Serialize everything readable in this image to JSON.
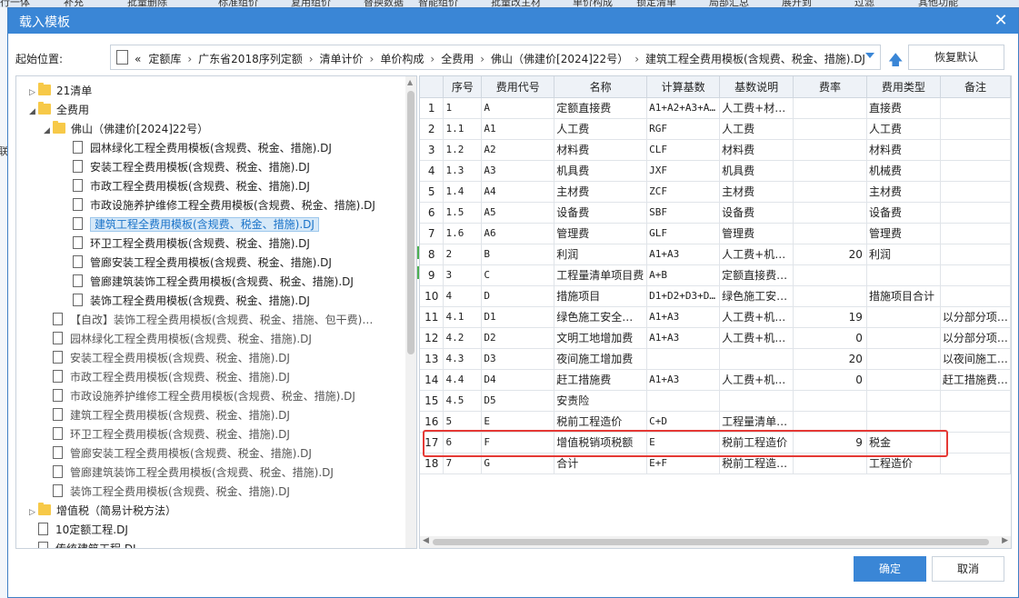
{
  "background": {
    "toolbar_items": [
      "行一体",
      "补充",
      "批量删除",
      "标准组价",
      "复用组价",
      "替换数据",
      "智能组价",
      "批量改主材",
      "单价构成",
      "锁定清单",
      "局部汇总",
      "展开到",
      "过滤",
      "其他功能"
    ],
    "left_fragment": "联"
  },
  "dialog": {
    "title": "载入模板",
    "close_glyph": "✕"
  },
  "path": {
    "label": "起始位置:",
    "prefix": "«",
    "crumbs": [
      "定额库",
      "广东省2018序列定额",
      "清单计价",
      "单价构成",
      "全费用",
      "佛山（佛建价[2024]22号）",
      "建筑工程全费用模板(含规费、税金、措施).DJ"
    ],
    "separator": "›",
    "up_glyph": "🡅",
    "restore_label": "恢复默认"
  },
  "tree": {
    "items": [
      {
        "indent": 0,
        "twisty": "▷",
        "kind": "folder",
        "label": "21清单"
      },
      {
        "indent": 0,
        "twisty": "◢",
        "kind": "folder",
        "label": "全费用"
      },
      {
        "indent": 1,
        "twisty": "◢",
        "kind": "folder",
        "label": "佛山（佛建价[2024]22号）"
      },
      {
        "indent": 2,
        "twisty": "",
        "kind": "doc",
        "label": "园林绿化工程全费用模板(含规费、税金、措施).DJ"
      },
      {
        "indent": 2,
        "twisty": "",
        "kind": "doc",
        "label": "安装工程全费用模板(含规费、税金、措施).DJ"
      },
      {
        "indent": 2,
        "twisty": "",
        "kind": "doc",
        "label": "市政工程全费用模板(含规费、税金、措施).DJ"
      },
      {
        "indent": 2,
        "twisty": "",
        "kind": "doc",
        "label": "市政设施养护维修工程全费用模板(含规费、税金、措施).DJ"
      },
      {
        "indent": 2,
        "twisty": "",
        "kind": "doc",
        "label": "建筑工程全费用模板(含规费、税金、措施).DJ",
        "selected": true
      },
      {
        "indent": 2,
        "twisty": "",
        "kind": "doc",
        "label": "环卫工程全费用模板(含规费、税金、措施).DJ"
      },
      {
        "indent": 2,
        "twisty": "",
        "kind": "doc",
        "label": "管廊安装工程全费用模板(含规费、税金、措施).DJ"
      },
      {
        "indent": 2,
        "twisty": "",
        "kind": "doc",
        "label": "管廊建筑装饰工程全费用模板(含规费、税金、措施).DJ"
      },
      {
        "indent": 2,
        "twisty": "",
        "kind": "doc",
        "label": "装饰工程全费用模板(含规费、税金、措施).DJ"
      },
      {
        "indent": 1,
        "twisty": "",
        "kind": "doc",
        "label": "【自改】装饰工程全费用模板(含规费、税金、措施、包干费)…",
        "dim": true
      },
      {
        "indent": 1,
        "twisty": "",
        "kind": "doc",
        "label": "园林绿化工程全费用模板(含规费、税金、措施).DJ",
        "dim": true
      },
      {
        "indent": 1,
        "twisty": "",
        "kind": "doc",
        "label": "安装工程全费用模板(含规费、税金、措施).DJ",
        "dim": true
      },
      {
        "indent": 1,
        "twisty": "",
        "kind": "doc",
        "label": "市政工程全费用模板(含规费、税金、措施).DJ",
        "dim": true
      },
      {
        "indent": 1,
        "twisty": "",
        "kind": "doc",
        "label": "市政设施养护维修工程全费用模板(含规费、税金、措施).DJ",
        "dim": true
      },
      {
        "indent": 1,
        "twisty": "",
        "kind": "doc",
        "label": "建筑工程全费用模板(含规费、税金、措施).DJ",
        "dim": true
      },
      {
        "indent": 1,
        "twisty": "",
        "kind": "doc",
        "label": "环卫工程全费用模板(含规费、税金、措施).DJ",
        "dim": true
      },
      {
        "indent": 1,
        "twisty": "",
        "kind": "doc",
        "label": "管廊安装工程全费用模板(含规费、税金、措施).DJ",
        "dim": true
      },
      {
        "indent": 1,
        "twisty": "",
        "kind": "doc",
        "label": "管廊建筑装饰工程全费用模板(含规费、税金、措施).DJ",
        "dim": true
      },
      {
        "indent": 1,
        "twisty": "",
        "kind": "doc",
        "label": "装饰工程全费用模板(含规费、税金、措施).DJ",
        "dim": true
      },
      {
        "indent": 0,
        "twisty": "▷",
        "kind": "folder",
        "label": "增值税（简易计税方法）"
      },
      {
        "indent": 0,
        "twisty": "",
        "kind": "doc",
        "label": "10定额工程.DJ"
      },
      {
        "indent": 0,
        "twisty": "",
        "kind": "doc",
        "label": "传统建筑工程.DJ"
      }
    ]
  },
  "grid": {
    "columns": [
      "",
      "序号",
      "费用代号",
      "名称",
      "计算基数",
      "基数说明",
      "费率",
      "费用类型",
      "备注"
    ],
    "rows": [
      [
        "1",
        "1",
        "A",
        "定额直接费",
        "A1+A2+A3+A…",
        "人工费+材…",
        "",
        "直接费",
        ""
      ],
      [
        "2",
        "1.1",
        "A1",
        "人工费",
        "RGF",
        "人工费",
        "",
        "人工费",
        ""
      ],
      [
        "3",
        "1.2",
        "A2",
        "材料费",
        "CLF",
        "材料费",
        "",
        "材料费",
        ""
      ],
      [
        "4",
        "1.3",
        "A3",
        "机具费",
        "JXF",
        "机具费",
        "",
        "机械费",
        ""
      ],
      [
        "5",
        "1.4",
        "A4",
        "主材费",
        "ZCF",
        "主材费",
        "",
        "主材费",
        ""
      ],
      [
        "6",
        "1.5",
        "A5",
        "设备费",
        "SBF",
        "设备费",
        "",
        "设备费",
        ""
      ],
      [
        "7",
        "1.6",
        "A6",
        "管理费",
        "GLF",
        "管理费",
        "",
        "管理费",
        ""
      ],
      [
        "8",
        "2",
        "B",
        "利润",
        "A1+A3",
        "人工费+机…",
        "20",
        "利润",
        ""
      ],
      [
        "9",
        "3",
        "C",
        "工程量清单项目费",
        "A+B",
        "定额直接费…",
        "",
        "",
        ""
      ],
      [
        "10",
        "4",
        "D",
        "措施项目",
        "D1+D2+D3+D…",
        "绿色施工安…",
        "",
        "措施项目合计",
        ""
      ],
      [
        "11",
        "4.1",
        "D1",
        "绿色施工安全…",
        "A1+A3",
        "人工费+机…",
        "19",
        "",
        "以分部分项…"
      ],
      [
        "12",
        "4.2",
        "D2",
        "文明工地增加费",
        "A1+A3",
        "人工费+机…",
        "0",
        "",
        "以分部分项…"
      ],
      [
        "13",
        "4.3",
        "D3",
        "夜间施工增加费",
        "",
        "",
        "20",
        "",
        "以夜间施工…"
      ],
      [
        "14",
        "4.4",
        "D4",
        "赶工措施费",
        "A1+A3",
        "人工费+机…",
        "0",
        "",
        "赶工措施费…"
      ],
      [
        "15",
        "4.5",
        "D5",
        "安责险",
        "",
        "",
        "",
        "",
        ""
      ],
      [
        "16",
        "5",
        "E",
        "税前工程造价",
        "C+D",
        "工程量清单…",
        "",
        "",
        ""
      ],
      [
        "17",
        "6",
        "F",
        "增值税销项税额",
        "E",
        "税前工程造价",
        "9",
        "税金",
        ""
      ],
      [
        "18",
        "7",
        "G",
        "合计",
        "E+F",
        "税前工程造…",
        "",
        "工程造价",
        ""
      ]
    ]
  },
  "footer": {
    "ok_label": "确定",
    "cancel_label": "取消"
  },
  "colors": {
    "accent": "#3a86d6",
    "highlight": "#e53935",
    "folder": "#f7c948"
  }
}
